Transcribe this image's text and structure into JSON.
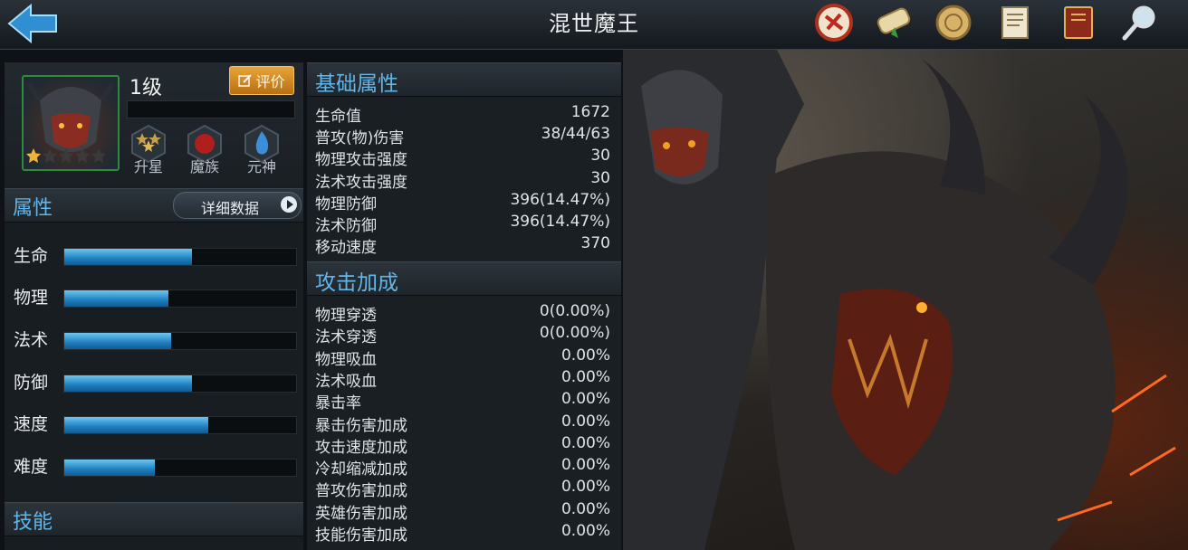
{
  "header": {
    "title": "混世魔王",
    "icons": [
      "back-arrow-icon",
      "battle-seal-icon",
      "scroll-icon",
      "coin-icon",
      "document-icon",
      "book-icon",
      "magnifier-icon"
    ]
  },
  "hero": {
    "level": "1级",
    "rate_label": "评价",
    "stars": "1 of 5",
    "badges": [
      {
        "label": "升星",
        "icon": "star-upgrade-icon"
      },
      {
        "label": "魔族",
        "icon": "demon-clan-icon"
      },
      {
        "label": "元神",
        "icon": "spirit-flame-icon"
      }
    ]
  },
  "attributes": {
    "title": "属性",
    "detail_button": "详细数据",
    "stats": [
      {
        "name": "生命",
        "value": 0.55
      },
      {
        "name": "物理",
        "value": 0.45
      },
      {
        "name": "法术",
        "value": 0.46
      },
      {
        "name": "防御",
        "value": 0.55
      },
      {
        "name": "速度",
        "value": 0.62
      },
      {
        "name": "难度",
        "value": 0.39
      }
    ]
  },
  "skills": {
    "title": "技能"
  },
  "base_attributes": {
    "title": "基础属性",
    "rows": [
      {
        "k": "生命值",
        "v": "1672"
      },
      {
        "k": "普攻(物)伤害",
        "v": "38/44/63"
      },
      {
        "k": "物理攻击强度",
        "v": "30"
      },
      {
        "k": "法术攻击强度",
        "v": "30"
      },
      {
        "k": "物理防御",
        "v": "396(14.47%)"
      },
      {
        "k": "法术防御",
        "v": "396(14.47%)"
      },
      {
        "k": "移动速度",
        "v": "370"
      }
    ]
  },
  "attack_bonus": {
    "title": "攻击加成",
    "rows": [
      {
        "k": "物理穿透",
        "v": "0(0.00%)"
      },
      {
        "k": "法术穿透",
        "v": "0(0.00%)"
      },
      {
        "k": "物理吸血",
        "v": "0.00%"
      },
      {
        "k": "法术吸血",
        "v": "0.00%"
      },
      {
        "k": "暴击率",
        "v": "0.00%"
      },
      {
        "k": "暴击伤害加成",
        "v": "0.00%"
      },
      {
        "k": "攻击速度加成",
        "v": "0.00%"
      },
      {
        "k": "冷却缩减加成",
        "v": "0.00%"
      },
      {
        "k": "普攻伤害加成",
        "v": "0.00%"
      },
      {
        "k": "英雄伤害加成",
        "v": "0.00%"
      },
      {
        "k": "技能伤害加成",
        "v": "0.00%"
      }
    ]
  },
  "colors": {
    "accent_blue": "#62b6ea",
    "bar_fill": "#1d7fc0",
    "rate_button": "#d48b22",
    "portrait_border": "#2f8a3c"
  }
}
